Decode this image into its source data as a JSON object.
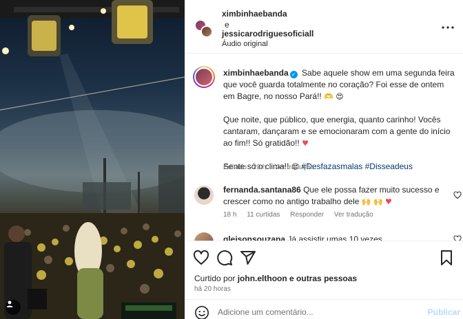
{
  "header": {
    "user1": "ximbinhaebanda",
    "connector": "e",
    "user2": "jessicarodriguesoficiall",
    "audio": "Áudio original"
  },
  "caption": {
    "user": "ximbinhaebanda",
    "line1": "Sabe aquele show em uma segunda feira que você guarda totalmente no coração? Foi esse de ontem em Bagre, no nosso Pará!!",
    "line1_emoji": "🫶 😍",
    "line2": "Que noite, que público, que energia, quanto carinho! Vocês cantaram, dançaram e se emocionaram com a gente do início ao fim!! Só gratidão!!",
    "line2_emoji": "♥",
    "line3": "Sente só o clima!!",
    "line3_emoji": "😍",
    "tag1": "#Desfazasmalas",
    "tag2": "#Disseadeus",
    "meta_edited": "Editado · 20 h",
    "meta_translate": "Ver tradução"
  },
  "comments": [
    {
      "user": "fernanda.santana86",
      "text": "Que ele possa fazer muito sucesso e crescer como no antigo trabalho dele",
      "emoji": "🙌 🙌",
      "heart": "♥",
      "time": "18 h",
      "likes": "11 curtidas",
      "reply": "Responder",
      "translate": "Ver tradução"
    },
    {
      "user": "gleisonsouzapa",
      "text": "Já assistir umas 10 vezes"
    }
  ],
  "actions": {
    "liked_prefix": "Curtido por",
    "liked_user": "john.elthoon",
    "liked_suffix": "e outras pessoas",
    "time_ago": "há 20 horas",
    "comment_placeholder": "Adicione um comentário...",
    "publish": "Publicar"
  },
  "colors": {
    "link": "#00376b",
    "verified": "#0095f6",
    "heart": "#ed4956",
    "publish_disabled": "#b3dbff"
  },
  "icons": [
    "more-icon",
    "verified-icon",
    "heart-icon",
    "comment-icon",
    "share-icon",
    "bookmark-icon",
    "emoji-icon",
    "user-tag-icon"
  ]
}
